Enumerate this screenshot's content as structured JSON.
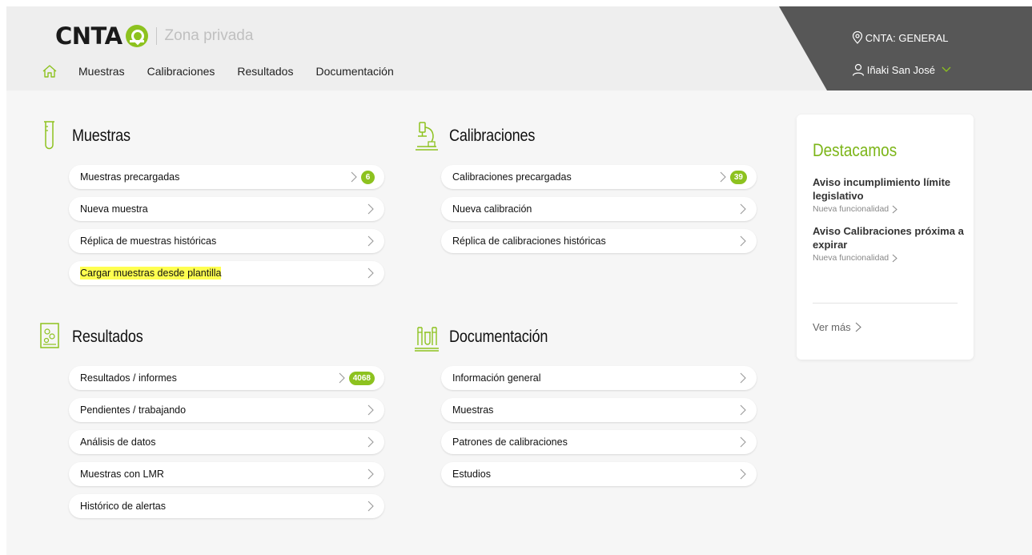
{
  "header": {
    "logo": "CNTA",
    "subtitle": "Zona privada",
    "nav": [
      "Muestras",
      "Calibraciones",
      "Resultados",
      "Documentación"
    ],
    "location": "CNTA: GENERAL",
    "user": "Iñaki San José"
  },
  "sections": {
    "muestras": {
      "title": "Muestras",
      "items": [
        {
          "label": "Muestras precargadas",
          "badge": "6"
        },
        {
          "label": "Nueva muestra"
        },
        {
          "label": "Réplica de muestras históricas"
        },
        {
          "label": "Cargar muestras desde plantilla",
          "highlighted": true
        }
      ]
    },
    "calibraciones": {
      "title": "Calibraciones",
      "items": [
        {
          "label": "Calibraciones precargadas",
          "badge": "39"
        },
        {
          "label": "Nueva calibración"
        },
        {
          "label": "Réplica de calibraciones históricas"
        }
      ]
    },
    "resultados": {
      "title": "Resultados",
      "items": [
        {
          "label": "Resultados / informes",
          "badge": "4068"
        },
        {
          "label": "Pendientes / trabajando"
        },
        {
          "label": "Análisis de datos"
        },
        {
          "label": "Muestras con LMR"
        },
        {
          "label": "Histórico de alertas"
        }
      ]
    },
    "documentacion": {
      "title": "Documentación",
      "items": [
        {
          "label": "Información general"
        },
        {
          "label": "Muestras"
        },
        {
          "label": "Patrones de calibraciones"
        },
        {
          "label": "Estudios"
        }
      ]
    }
  },
  "destacamos": {
    "title": "Destacamos",
    "news": [
      {
        "title": "Aviso incumplimiento límite legislativo",
        "sub": "Nueva funcionalidad"
      },
      {
        "title": "Aviso Calibraciones próxima a expirar",
        "sub": "Nueva funcionalidad"
      }
    ],
    "more": "Ver más"
  },
  "colors": {
    "accent": "#8dc21f",
    "header_dark": "#575757",
    "highlight": "#ffff50"
  }
}
